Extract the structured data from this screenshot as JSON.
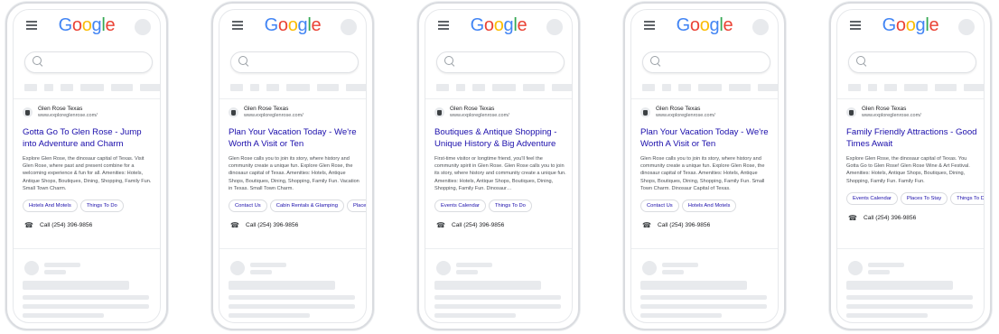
{
  "logo": [
    "G",
    "o",
    "o",
    "g",
    "l",
    "e"
  ],
  "colors": {
    "logo": [
      "#4285F4",
      "#EA4335",
      "#FBBC05",
      "#4285F4",
      "#34A853",
      "#EA4335"
    ],
    "link": "#1a0dab",
    "skeleton": "#e8eaed"
  },
  "icons": {
    "menu": "hamburger-menu-icon",
    "search": "magnifier-icon",
    "call": "phone-icon",
    "favicon": "shield-icon"
  },
  "phones": [
    {
      "site": "Glen Rose Texas",
      "url": "www.exploreglenrose.com/",
      "headline": "Gotta Go To Glen Rose - Jump into Adventure and Charm",
      "description": "Explore Glen Rose, the dinosaur capital of Texas. Visit Glen Rose, where past and present combine for a welcoming experience & fun for all. Amenities: Hotels, Antique Shops, Boutiques, Dining, Shopping, Family Fun. Small Town Charm.",
      "sitelinks": [
        "Hotels And Motels",
        "Things To Do"
      ],
      "call": "Call (254) 396-9856"
    },
    {
      "site": "Glen Rose Texas",
      "url": "www.exploreglenrose.com/",
      "headline": "Plan Your Vacation Today - We're Worth A Visit or Ten",
      "description": "Glen Rose calls you to join its story, where history and community create a unique fun. Explore Glen Rose, the dinosaur capital of Texas. Amenities: Hotels, Antique Shops, Boutiques, Dining, Shopping, Family Fun. Vacation in Texas. Small Town Charm.",
      "sitelinks": [
        "Contact Us",
        "Cabin Rentals & Glamping",
        "Places"
      ],
      "call": "Call (254) 396-9856"
    },
    {
      "site": "Glen Rose Texas",
      "url": "www.exploreglenrose.com/",
      "headline": "Boutiques & Antique Shopping - Unique History & Big Adventure",
      "description": "First-time visitor or longtime friend, you'll feel the community spirit in Glen Rose. Glen Rose calls you to join its story, where history and community create a unique fun. Amenities: Hotels, Antique Shops, Boutiques, Dining, Shopping, Family Fun. Dinosaur…",
      "sitelinks": [
        "Events Calendar",
        "Things To Do"
      ],
      "call": "Call (254) 396-9856"
    },
    {
      "site": "Glen Rose Texas",
      "url": "www.exploreglenrose.com/",
      "headline": "Plan Your Vacation Today - We're Worth A Visit or Ten",
      "description": "Glen Rose calls you to join its story, where history and community create a unique fun. Explore Glen Rose, the dinosaur capital of Texas. Amenities: Hotels, Antique Shops, Boutiques, Dining, Shopping, Family Fun. Small Town Charm. Dinosaur Capital of Texas.",
      "sitelinks": [
        "Contact Us",
        "Hotels And Motels"
      ],
      "call": "Call (254) 396-9856"
    },
    {
      "site": "Glen Rose Texas",
      "url": "www.exploreglenrose.com/",
      "headline": "Family Friendly Attractions - Good Times Await",
      "description": "Explore Glen Rose, the dinosaur capital of Texas. You Gotta Go to Glen Rose! Glen Rose Wine & Art Festival. Amenities: Hotels, Antique Shops, Boutiques, Dining, Shopping, Family Fun. Family Fun.",
      "sitelinks": [
        "Events Calendar",
        "Places To Stay",
        "Things To Do"
      ],
      "call": "Call (254) 396-9856"
    }
  ]
}
